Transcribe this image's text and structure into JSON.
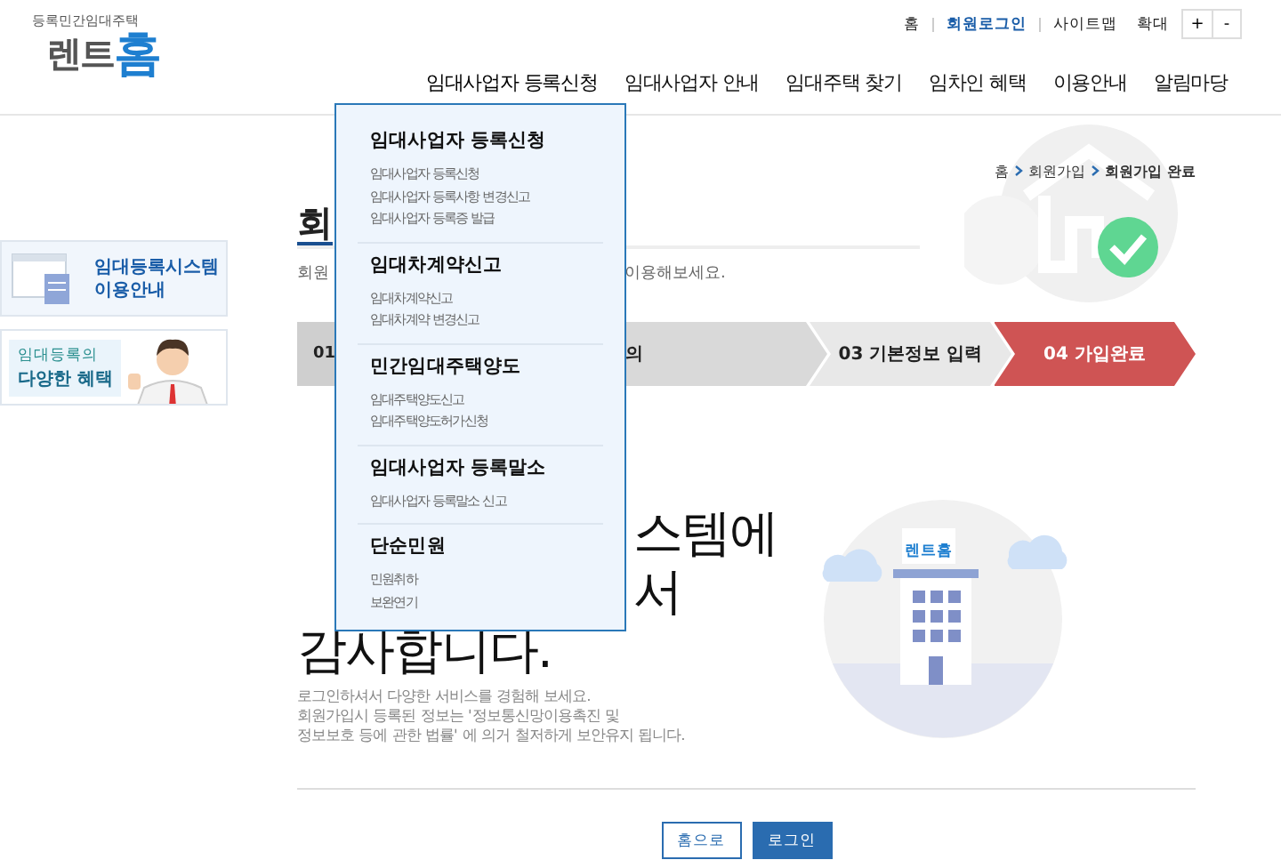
{
  "logo": {
    "tagline": "등록민간임대주택",
    "name": "렌트",
    "name_accent": "홈"
  },
  "utility_links": [
    {
      "label": "홈",
      "selected": false
    },
    {
      "label": "회원로그인",
      "selected": true
    },
    {
      "label": "사이트맵",
      "selected": false
    }
  ],
  "zoom": {
    "label": "확대",
    "buttons": [
      "+",
      "-"
    ]
  },
  "nav": [
    {
      "label": "임대사업자 등록신청",
      "expanded": true
    },
    {
      "label": "임대사업자 안내",
      "expanded": false
    },
    {
      "label": "임대주택 찾기",
      "expanded": false
    },
    {
      "label": "임차인 혜택",
      "expanded": false
    },
    {
      "label": "이용안내",
      "expanded": false
    },
    {
      "label": "알림마당",
      "expanded": false
    }
  ],
  "mega_menu": [
    {
      "title": "임대사업자 등록신청",
      "items": [
        "임대사업자 등록신청",
        "임대사업자 등록사항 변경신고",
        "임대사업자 등록증 발급"
      ]
    },
    {
      "title": "임대차계약신고",
      "items": [
        "임대차계약신고",
        "임대차계약 변경신고"
      ]
    },
    {
      "title": "민간임대주택양도",
      "items": [
        "임대주택양도신고",
        "임대주택양도허가신청"
      ]
    },
    {
      "title": "임대사업자 등록말소",
      "items": [
        "임대사업자 등록말소 신고"
      ]
    },
    {
      "title": "단순민원",
      "items": [
        "민원취하",
        "보완연기"
      ]
    }
  ],
  "side_banners": [
    {
      "kind": "document",
      "lines": [
        "임대등록시스템",
        "이용안내"
      ]
    },
    {
      "kind": "person",
      "lines": [
        "임대등록의",
        "다양한 혜택"
      ]
    }
  ],
  "breadcrumb": [
    "홈",
    "회원가입",
    "회원가입 완료"
  ],
  "title": "회",
  "description": [
    "회원",
    "이용해보세요."
  ],
  "steps": [
    {
      "label": "01",
      "selected": false
    },
    {
      "label": "의",
      "selected": false
    },
    {
      "label": "03 기본정보 입력",
      "selected": false
    },
    {
      "label": "04 가입완료",
      "selected": true
    }
  ],
  "thanks_lines": [
    "스템에",
    "서",
    "감사합니다."
  ],
  "notice_lines": [
    "로그인하셔서 다양한 서비스를 경험해 보세요.",
    "회원가입시 등록된 정보는 '정보통신망이용촉진 및",
    "정보보호 등에 관한 법률' 에 의거 철저하게 보안유지 됩니다."
  ],
  "illustration": {
    "sign": "렌트홈"
  },
  "buttons": [
    {
      "label": "홈으로",
      "kind": "outline"
    },
    {
      "label": "로그인",
      "kind": "primary"
    }
  ]
}
